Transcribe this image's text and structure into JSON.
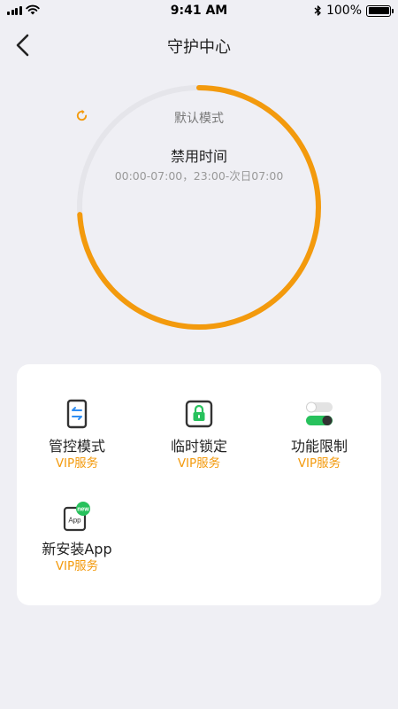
{
  "status_bar": {
    "time": "9:41 AM",
    "battery": "100%"
  },
  "nav": {
    "title": "守护中心",
    "back_icon": "chevron-left-icon"
  },
  "ring": {
    "mode_label": "默认模式",
    "title": "禁用时间",
    "schedule": "00:00-07:00，23:00-次日07:00",
    "progress_fraction": 0.74,
    "accent_color": "#f39a0d",
    "track_color": "#e5e5ea"
  },
  "features": [
    {
      "label": "管控模式",
      "sub": "VIP服务",
      "icon": "phone-swap-icon"
    },
    {
      "label": "临时锁定",
      "sub": "VIP服务",
      "icon": "lock-icon"
    },
    {
      "label": "功能限制",
      "sub": "VIP服务",
      "icon": "toggle-icon"
    },
    {
      "label": "新安装App",
      "sub": "VIP服务",
      "icon": "new-app-icon",
      "badge": "new",
      "icon_text": "App"
    }
  ]
}
